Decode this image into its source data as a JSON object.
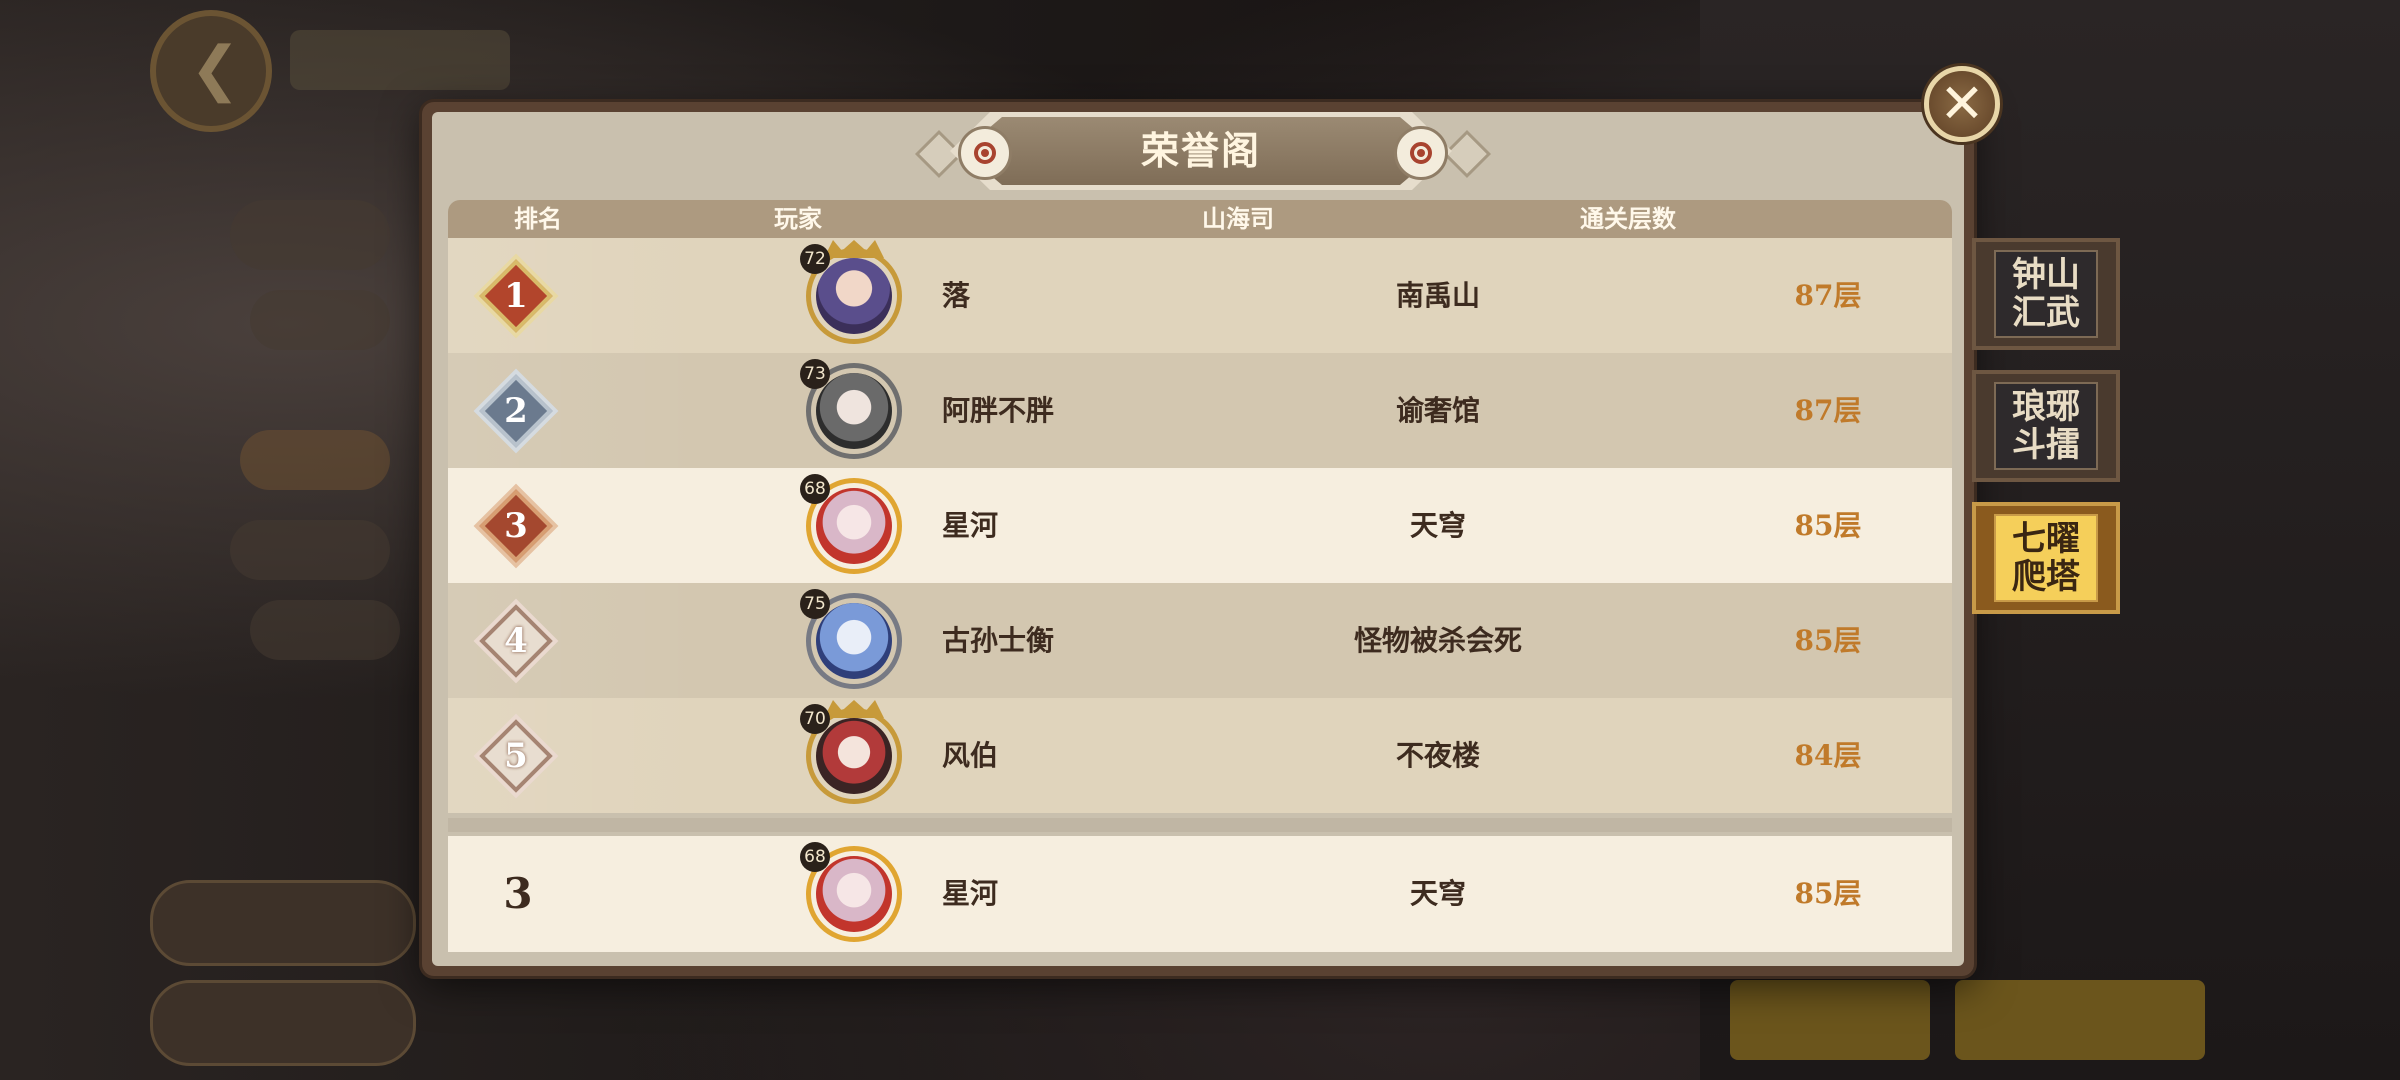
{
  "dialog": {
    "title": "荣誉阁",
    "close_icon": "close-icon"
  },
  "table": {
    "headers": [
      "排名",
      "玩家",
      "山海司",
      "通关层数"
    ],
    "rows": [
      {
        "rank": "1",
        "level": "72",
        "player": "落",
        "guild": "南禹山",
        "floors": "87层"
      },
      {
        "rank": "2",
        "level": "73",
        "player": "阿胖不胖",
        "guild": "谕奢馆",
        "floors": "87层"
      },
      {
        "rank": "3",
        "level": "68",
        "player": "星河",
        "guild": "天穹",
        "floors": "85层"
      },
      {
        "rank": "4",
        "level": "75",
        "player": "古孙士衡",
        "guild": "怪物被杀会死",
        "floors": "85层"
      },
      {
        "rank": "5",
        "level": "70",
        "player": "风伯",
        "guild": "不夜楼",
        "floors": "84层"
      }
    ],
    "self": {
      "rank": "3",
      "level": "68",
      "player": "星河",
      "guild": "天穹",
      "floors": "85层"
    }
  },
  "tabs": [
    {
      "label": "钟山\n汇武",
      "active": false
    },
    {
      "label": "琅琊\n斗擂",
      "active": false
    },
    {
      "label": "七曜\n爬塔",
      "active": true
    }
  ],
  "colors": {
    "floor_text": "#c07a2a",
    "active_tab": "#f5cf5a",
    "header_bar": "#ad9a80"
  }
}
